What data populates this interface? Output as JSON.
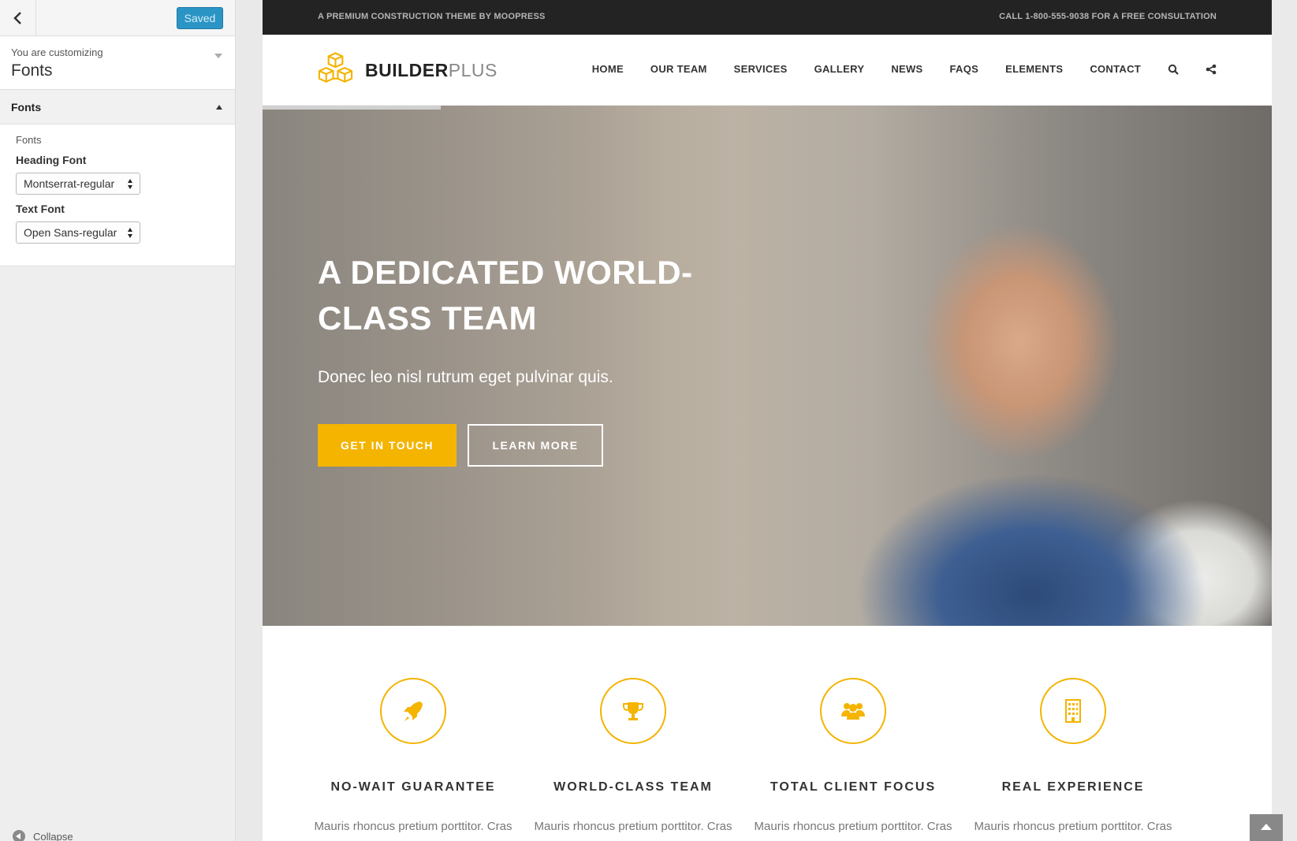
{
  "customizer": {
    "saved_label": "Saved",
    "info_sub": "You are customizing",
    "info_title": "Fonts",
    "section_title": "Fonts",
    "group_label": "Fonts",
    "heading_font_label": "Heading Font",
    "heading_font_value": "Montserrat-regular",
    "text_font_label": "Text Font",
    "text_font_value": "Open Sans-regular",
    "collapse_label": "Collapse"
  },
  "site": {
    "topbar_left": "A PREMIUM CONSTRUCTION THEME BY MOOPRESS",
    "topbar_right": "CALL 1-800-555-9038 FOR A FREE CONSULTATION",
    "logo_bold": "BUILDER",
    "logo_light": "PLUS",
    "nav": [
      "HOME",
      "OUR TEAM",
      "SERVICES",
      "GALLERY",
      "NEWS",
      "FAQS",
      "ELEMENTS",
      "CONTACT"
    ],
    "hero": {
      "headline": "A DEDICATED WORLD-CLASS TEAM",
      "tagline": "Donec leo nisl rutrum eget pulvinar quis.",
      "primary_button": "GET IN TOUCH",
      "secondary_button": "LEARN MORE"
    },
    "features": [
      {
        "icon": "rocket-icon",
        "title": "NO-WAIT GUARANTEE",
        "text": "Mauris rhoncus pretium porttitor. Cras"
      },
      {
        "icon": "trophy-icon",
        "title": "WORLD-CLASS TEAM",
        "text": "Mauris rhoncus pretium porttitor. Cras"
      },
      {
        "icon": "group-icon",
        "title": "TOTAL CLIENT FOCUS",
        "text": "Mauris rhoncus pretium porttitor. Cras"
      },
      {
        "icon": "building-icon",
        "title": "REAL EXPERIENCE",
        "text": "Mauris rhoncus pretium porttitor. Cras"
      }
    ]
  },
  "colors": {
    "accent": "#f4b400",
    "topbar_bg": "#232323",
    "saved_button": "#2a95c5"
  }
}
